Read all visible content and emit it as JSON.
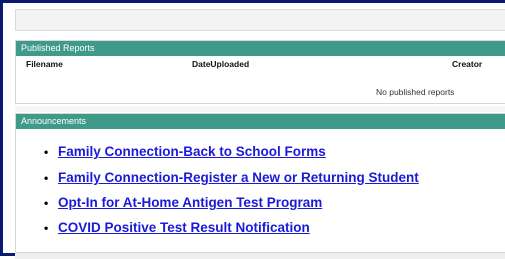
{
  "reports": {
    "header": "Published Reports",
    "columns": {
      "filename": "Filename",
      "date": "DateUploaded",
      "creator": "Creator"
    },
    "empty_message": "No published reports"
  },
  "announcements": {
    "header": "Announcements",
    "links": [
      "Family Connection-Back to School Forms",
      "Family Connection-Register a New or Returning Student",
      "Opt-In for At-Home Antigen Test Program",
      "COVID Positive Test Result Notification"
    ]
  },
  "colors": {
    "panel_header": "#3f9a8a",
    "link": "#1a1ad8",
    "frame_border": "#0a1a73"
  }
}
